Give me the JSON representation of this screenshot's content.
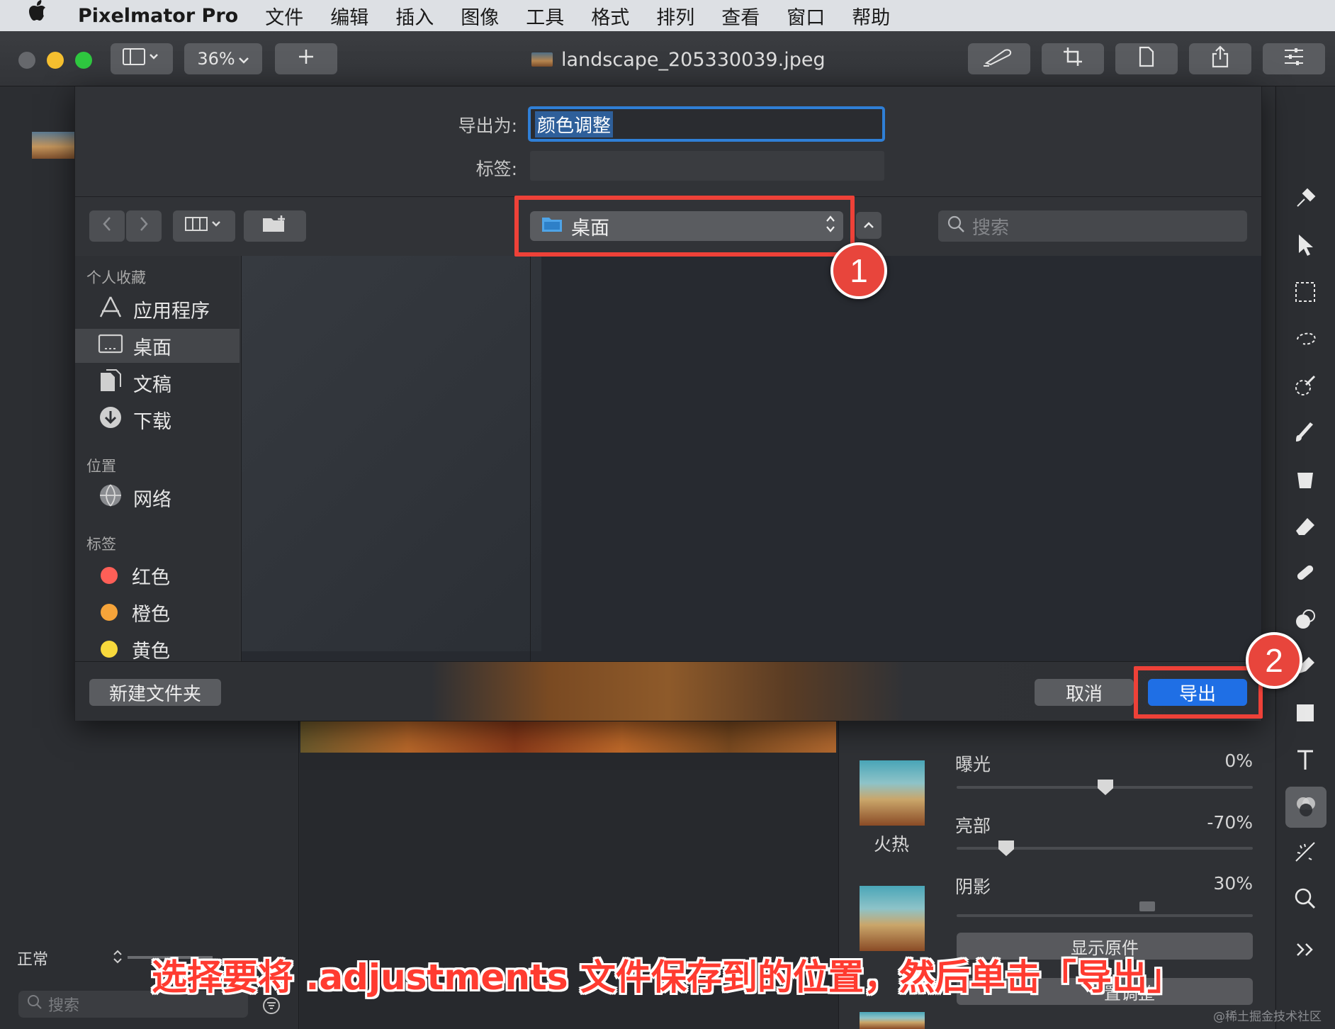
{
  "menubar": {
    "app_name": "Pixelmator Pro",
    "items": [
      "文件",
      "编辑",
      "插入",
      "图像",
      "工具",
      "格式",
      "排列",
      "查看",
      "窗口",
      "帮助"
    ]
  },
  "toolbar": {
    "zoom": "36%",
    "document_title": "landscape_205330039.jpeg",
    "icons": [
      "sidebar-toggle-icon",
      "plus-icon",
      "pen-icon",
      "crop-icon",
      "document-icon",
      "share-icon",
      "sliders-icon"
    ]
  },
  "export_sheet": {
    "export_as_label": "导出为:",
    "export_as_value": "颜色调整",
    "tags_label": "标签:",
    "tags_value": "",
    "location": "桌面",
    "search_placeholder": "搜索",
    "sidebar": {
      "favorites_header": "个人收藏",
      "favorites": [
        {
          "label": "应用程序",
          "icon": "applications-icon"
        },
        {
          "label": "桌面",
          "icon": "desktop-icon",
          "selected": true
        },
        {
          "label": "文稿",
          "icon": "documents-icon"
        },
        {
          "label": "下载",
          "icon": "downloads-icon"
        }
      ],
      "locations_header": "位置",
      "locations": [
        {
          "label": "网络",
          "icon": "network-icon"
        }
      ],
      "tags_header": "标签",
      "tags": [
        {
          "label": "红色",
          "color": "#ff5f57"
        },
        {
          "label": "橙色",
          "color": "#f6a43a"
        },
        {
          "label": "黄色",
          "color": "#f8d93c"
        }
      ]
    },
    "new_folder_button": "新建文件夹",
    "cancel_button": "取消",
    "export_button": "导出"
  },
  "adjustments_panel": {
    "preset_label": "火热",
    "rows": [
      {
        "label": "曝光",
        "value": "0%",
        "level": 0.5
      },
      {
        "label": "亮部",
        "value": "-70%",
        "level": 0.15
      },
      {
        "label": "阴影",
        "value": "30%",
        "level": 0.65
      }
    ],
    "show_original_button": "显示原件",
    "reset_button_partial": "置调整"
  },
  "layers_panel": {
    "blend_mode": "正常",
    "search_placeholder": "搜索"
  },
  "annotations": {
    "step1": "1",
    "step2": "2",
    "caption": "选择要将 .adjustments 文件保存到的位置，然后单击「导出」",
    "accent_color": "#ee4138"
  },
  "watermark": "@稀土掘金技术社区"
}
